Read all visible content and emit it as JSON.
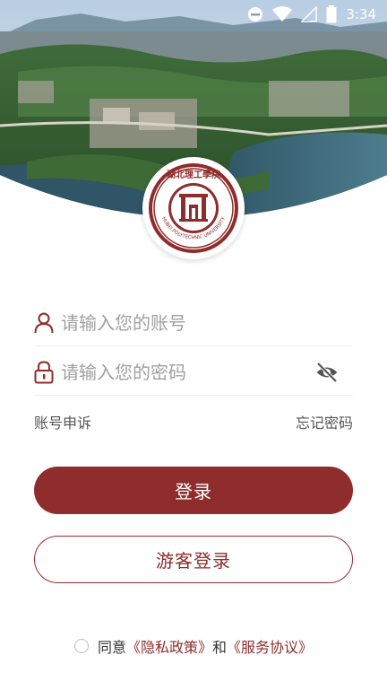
{
  "status_bar": {
    "time": "3:34",
    "icons": [
      "dnd-icon",
      "wifi-icon",
      "signal-icon",
      "battery-icon"
    ]
  },
  "header": {
    "image": "campus-aerial-photo",
    "logo": "hubei-polytechnic-university-seal",
    "logo_text_cn": "湖北理工學院",
    "logo_text_en": "HUBEI POLYTECHNIC UNIVERSITY"
  },
  "form": {
    "account_placeholder": "请输入您的账号",
    "password_placeholder": "请输入您的密码",
    "account_icon": "user-icon",
    "password_icon": "lock-icon",
    "toggle_icon": "eye-off-icon"
  },
  "links": {
    "appeal": "账号申诉",
    "forgot": "忘记密码"
  },
  "buttons": {
    "login": "登录",
    "guest": "游客登录"
  },
  "agreement": {
    "prefix": "同意",
    "privacy": "《隐私政策》",
    "and": "和",
    "service": "《服务协议》"
  },
  "colors": {
    "brand": "#8e2d2b",
    "placeholder": "#a0a0a0",
    "divider": "#eeeeee"
  }
}
